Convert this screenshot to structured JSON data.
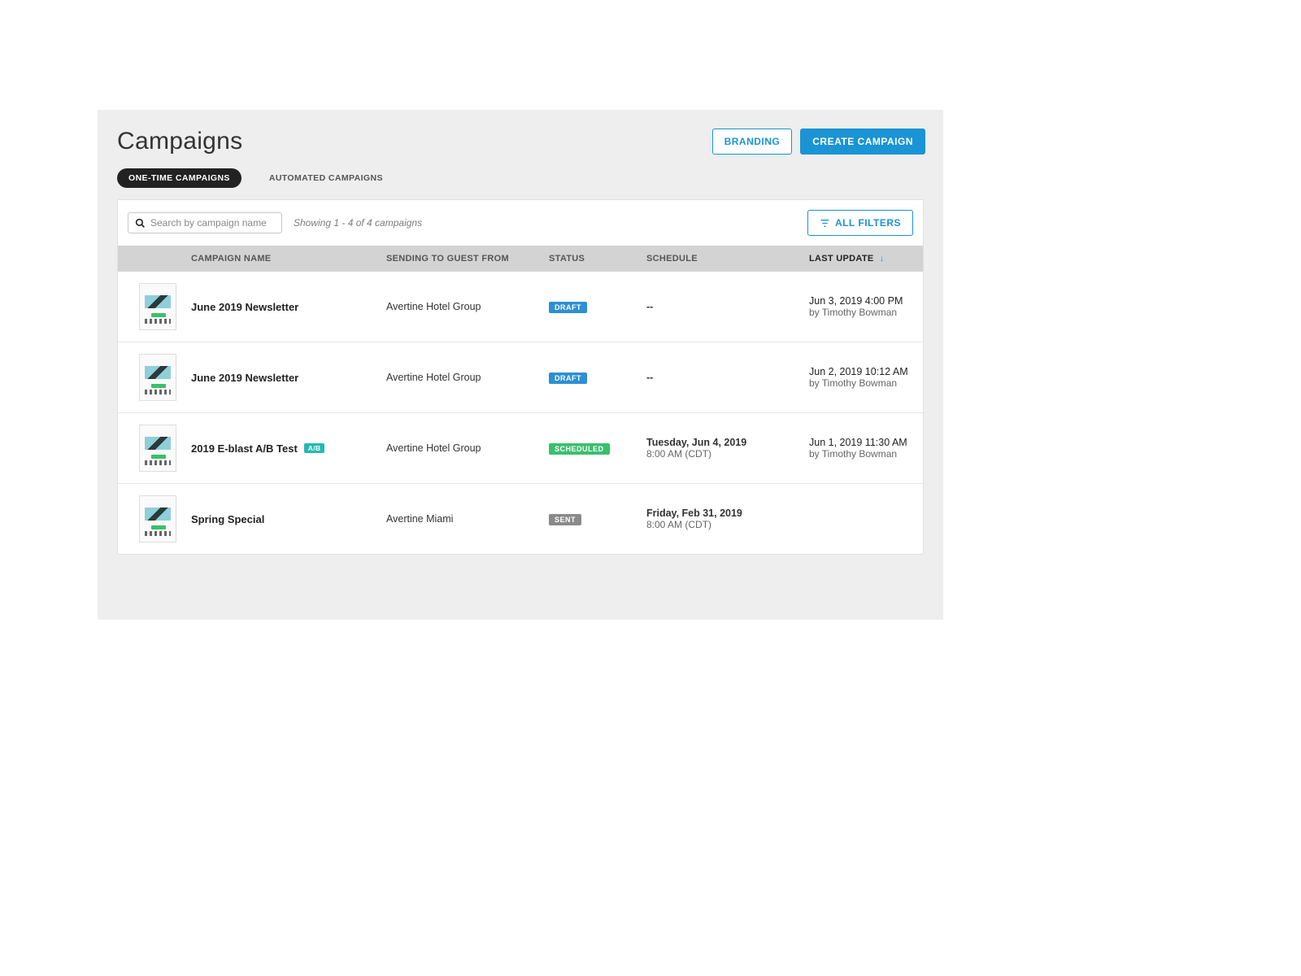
{
  "header": {
    "title": "Campaigns",
    "branding_label": "BRANDING",
    "create_label": "CREATE CAMPAIGN"
  },
  "tabs": {
    "one_time": "ONE-TIME CAMPAIGNS",
    "automated": "AUTOMATED CAMPAIGNS"
  },
  "toolbar": {
    "search_placeholder": "Search by campaign name",
    "showing_text": "Showing 1 - 4 of 4 campaigns",
    "all_filters_label": "ALL FILTERS"
  },
  "columns": {
    "name": "CAMPAIGN NAME",
    "sending": "SENDING TO GUEST FROM",
    "status": "STATUS",
    "schedule": "SCHEDULE",
    "last_update": "LAST UPDATE"
  },
  "rows": [
    {
      "name": "June 2019 Newsletter",
      "ab_badge": "",
      "sending_to": "Avertine Hotel Group",
      "status_code": "draft",
      "status_label": "DRAFT",
      "schedule_date": "--",
      "schedule_time": "",
      "update_date": "Jun 3, 2019 4:00 PM",
      "update_by": "by Timothy Bowman"
    },
    {
      "name": "June 2019 Newsletter",
      "ab_badge": "",
      "sending_to": "Avertine Hotel Group",
      "status_code": "draft",
      "status_label": "DRAFT",
      "schedule_date": "--",
      "schedule_time": "",
      "update_date": "Jun 2, 2019 10:12 AM",
      "update_by": "by Timothy Bowman"
    },
    {
      "name": "2019 E-blast  A/B Test",
      "ab_badge": "A/B",
      "sending_to": "Avertine Hotel Group",
      "status_code": "scheduled",
      "status_label": "SCHEDULED",
      "schedule_date": "Tuesday, Jun 4, 2019",
      "schedule_time": "8:00 AM (CDT)",
      "update_date": "Jun 1, 2019 11:30 AM",
      "update_by": "by Timothy Bowman"
    },
    {
      "name": "Spring Special",
      "ab_badge": "",
      "sending_to": "Avertine Miami",
      "status_code": "sent",
      "status_label": "SENT",
      "schedule_date": "Friday, Feb 31, 2019",
      "schedule_time": "8:00 AM (CDT)",
      "update_date": "",
      "update_by": ""
    }
  ]
}
